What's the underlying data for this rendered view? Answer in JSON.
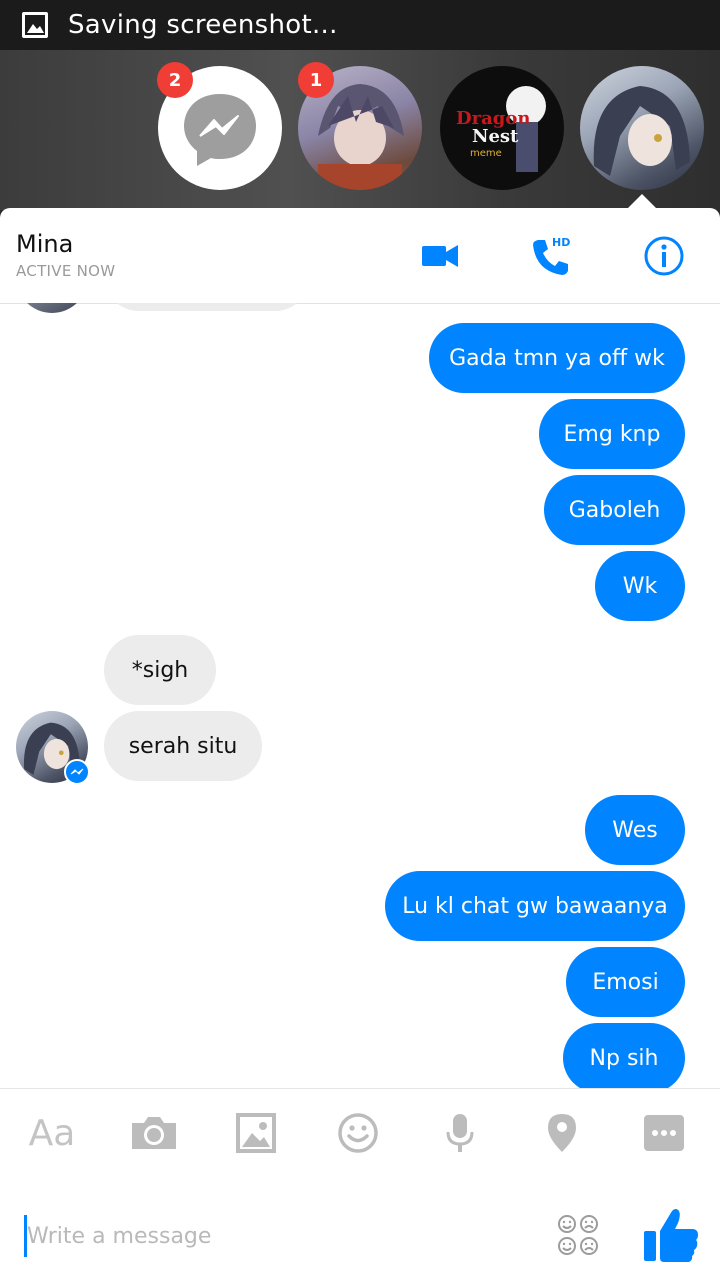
{
  "status_bar": {
    "title": "Saving screenshot..."
  },
  "chat_heads": [
    {
      "name": "messenger",
      "badge": "2"
    },
    {
      "name": "anime-boy",
      "badge": "1"
    },
    {
      "name": "dragon-nest",
      "badge": ""
    },
    {
      "name": "mina",
      "badge": ""
    }
  ],
  "dragon_nest_logo": {
    "line1": "Dragon",
    "line2": "Nest",
    "line3": "meme"
  },
  "header": {
    "name": "Mina",
    "status": "ACTIVE NOW",
    "hd_label": "HD"
  },
  "messages": [
    {
      "from": "me",
      "text": "Gada tmn ya off wk"
    },
    {
      "from": "me",
      "text": "Emg knp"
    },
    {
      "from": "me",
      "text": "Gaboleh"
    },
    {
      "from": "me",
      "text": "Wk"
    },
    {
      "from": "them",
      "text": "*sigh"
    },
    {
      "from": "them",
      "text": "serah situ"
    },
    {
      "from": "me",
      "text": "Wes"
    },
    {
      "from": "me",
      "text": "Lu kl chat gw bawaanya"
    },
    {
      "from": "me",
      "text": "Emosi"
    },
    {
      "from": "me",
      "text": "Np sih"
    }
  ],
  "toolbar": {
    "text_tool_label": "Aa"
  },
  "composer": {
    "placeholder": "Write a message"
  },
  "colors": {
    "accent": "#0084ff",
    "badge": "#f03d35",
    "incoming_bubble": "#ececec"
  }
}
